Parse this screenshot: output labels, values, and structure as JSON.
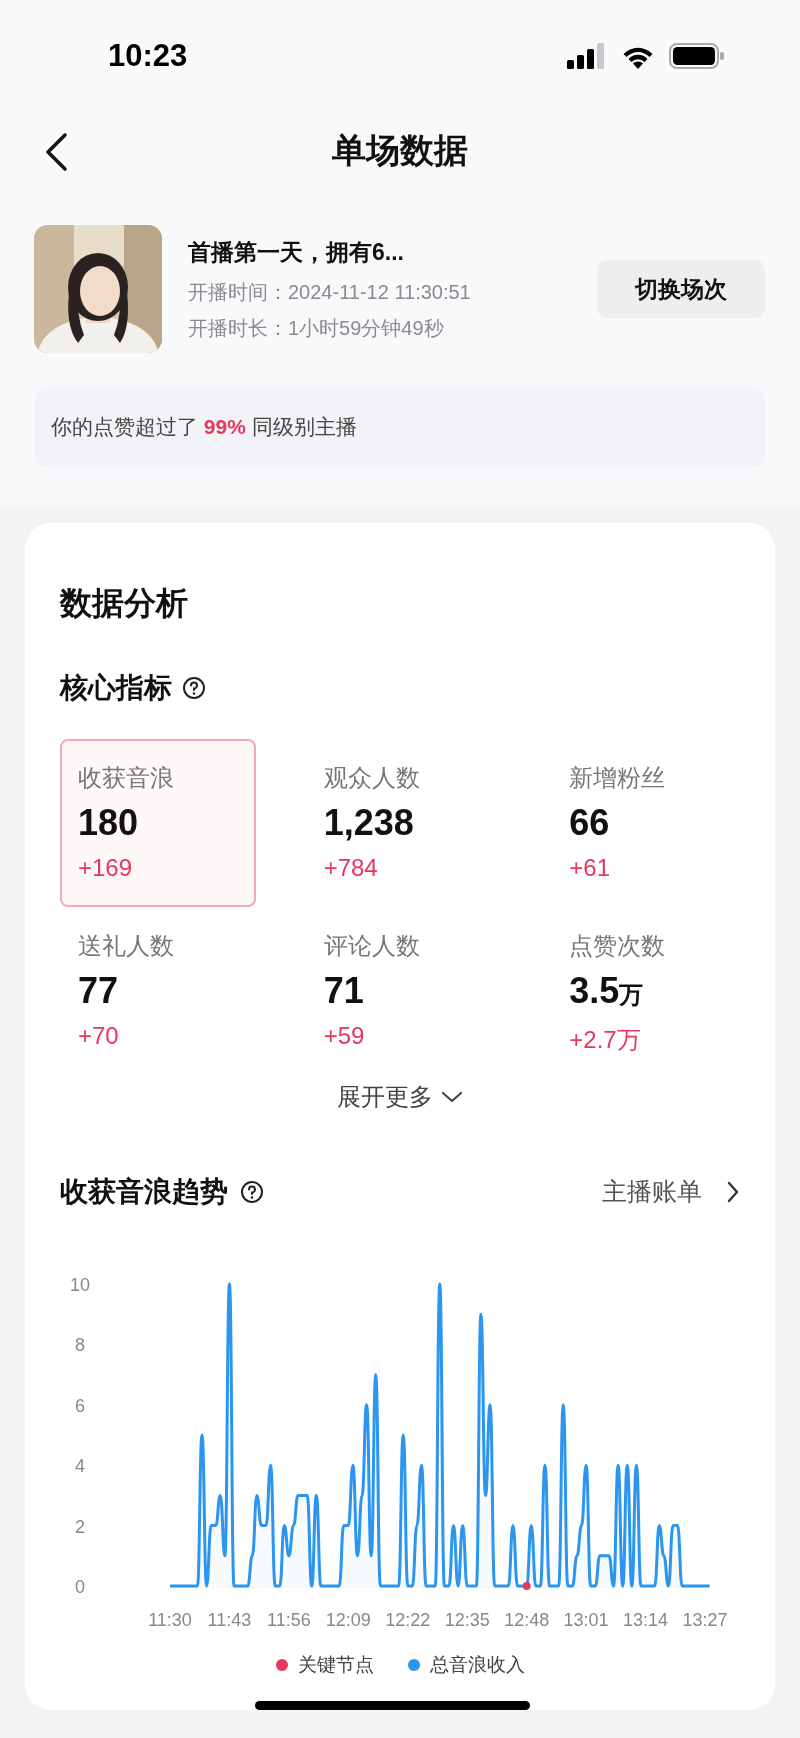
{
  "status_bar": {
    "time": "10:23"
  },
  "nav": {
    "title": "单场数据"
  },
  "session": {
    "title": "首播第一天，拥有6...",
    "start_time": "开播时间：2024-11-12 11:30:51",
    "duration": "开播时长：1小时59分钟49秒",
    "switch_button": "切换场次"
  },
  "banner": "你的点赞超过了 **99%** 同级别主播",
  "analysis": {
    "title": "数据分析",
    "core_title": "核心指标",
    "metrics": [
      {
        "label": "收获音浪",
        "value": "180",
        "delta": "+169",
        "selected": true
      },
      {
        "label": "观众人数",
        "value": "1,238",
        "delta": "+784",
        "selected": false
      },
      {
        "label": "新增粉丝",
        "value": "66",
        "delta": "+61",
        "selected": false
      },
      {
        "label": "送礼人数",
        "value": "77",
        "delta": "+70",
        "selected": false
      },
      {
        "label": "评论人数",
        "value": "71",
        "delta": "+59",
        "selected": false
      },
      {
        "label": "点赞次数",
        "value": "3.5",
        "unit": "万",
        "delta": "+2.7万",
        "selected": false
      }
    ],
    "expand": "展开更多"
  },
  "trend": {
    "title": "收获音浪趋势",
    "link": "主播账单",
    "chart_data": {
      "type": "line",
      "categories": [
        "11:30",
        null,
        null,
        null,
        null,
        null,
        null,
        null,
        null,
        null,
        null,
        null,
        null,
        "11:43",
        null,
        null,
        null,
        null,
        null,
        null,
        null,
        null,
        null,
        null,
        null,
        null,
        "11:56",
        null,
        null,
        null,
        null,
        null,
        null,
        null,
        null,
        null,
        null,
        null,
        null,
        "12:09",
        null,
        null,
        null,
        null,
        null,
        null,
        null,
        null,
        null,
        null,
        null,
        null,
        "12:22",
        null,
        null,
        null,
        null,
        null,
        null,
        null,
        null,
        null,
        null,
        null,
        null,
        "12:35",
        null,
        null,
        null,
        null,
        null,
        null,
        null,
        null,
        null,
        null,
        null,
        null,
        "12:48",
        null,
        null,
        null,
        null,
        null,
        null,
        null,
        null,
        null,
        null,
        null,
        null,
        "13:01",
        null,
        null,
        null,
        null,
        null,
        null,
        null,
        null,
        null,
        null,
        null,
        null,
        "13:14",
        null,
        null,
        null,
        null,
        null,
        null,
        null,
        null,
        null,
        null,
        null,
        null,
        "13:27",
        null
      ],
      "series": [
        {
          "name": "关键节点",
          "color": "#e8365d",
          "marker": "circle",
          "values": [
            null,
            null,
            null,
            null,
            null,
            null,
            null,
            null,
            null,
            null,
            null,
            null,
            null,
            null,
            null,
            null,
            null,
            null,
            null,
            null,
            null,
            null,
            null,
            null,
            null,
            null,
            null,
            null,
            null,
            null,
            null,
            null,
            null,
            null,
            null,
            null,
            null,
            null,
            null,
            null,
            null,
            null,
            null,
            null,
            null,
            null,
            null,
            null,
            null,
            null,
            null,
            null,
            null,
            null,
            null,
            null,
            null,
            null,
            null,
            null,
            null,
            null,
            null,
            null,
            null,
            null,
            null,
            null,
            null,
            null,
            null,
            null,
            null,
            null,
            null,
            null,
            null,
            null,
            0,
            null,
            null,
            null,
            null,
            null,
            null,
            null,
            null,
            null,
            null,
            null,
            null,
            null,
            null,
            null,
            null,
            null,
            null,
            null,
            null,
            null,
            null,
            null,
            null,
            null,
            null,
            null,
            null,
            null,
            null,
            null,
            null,
            null,
            null,
            null,
            null,
            null,
            null,
            null,
            null
          ]
        },
        {
          "name": "总音浪收入",
          "color": "#2b95f0",
          "values": [
            0,
            0,
            0,
            0,
            0,
            0,
            0,
            5,
            0,
            2,
            2,
            3,
            1,
            10,
            0,
            0,
            0,
            0,
            1,
            3,
            2,
            2,
            4,
            0,
            0,
            2,
            1,
            2,
            3,
            3,
            3,
            0,
            3,
            0,
            0,
            0,
            0,
            0,
            2,
            2,
            4,
            1,
            3,
            6,
            1,
            7,
            0,
            0,
            0,
            0,
            0,
            5,
            0,
            0,
            2,
            4,
            0,
            0,
            0,
            10,
            0,
            0,
            2,
            0,
            2,
            0,
            0,
            0,
            9,
            3,
            6,
            0,
            0,
            0,
            0,
            2,
            0,
            0,
            0,
            2,
            0,
            0,
            4,
            0,
            0,
            0,
            6,
            0,
            0,
            1,
            2,
            4,
            0,
            0,
            1,
            1,
            1,
            0,
            4,
            0,
            4,
            0,
            4,
            0,
            0,
            0,
            0,
            2,
            1,
            0,
            2,
            2,
            0,
            0,
            0,
            0,
            0,
            0,
            0
          ]
        }
      ],
      "ylim": [
        0,
        10
      ],
      "yticks": [
        0,
        2,
        4,
        6,
        8,
        10
      ]
    }
  }
}
